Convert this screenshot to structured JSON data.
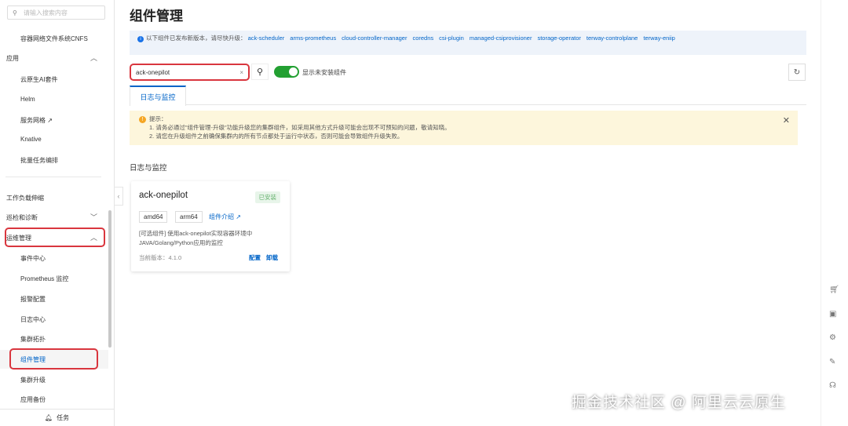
{
  "sidebar": {
    "search_placeholder": "请输入搜索内容",
    "items": [
      "容器网络文件系统CNFS",
      "云原生AI套件",
      "Helm",
      "服务网格",
      "Knative",
      "批量任务编排",
      "事件中心",
      "Prometheus 监控",
      "报警配置",
      "日志中心",
      "集群拓扑",
      "组件管理",
      "集群升级",
      "应用备份"
    ],
    "groups": [
      "应用",
      "工作负载伸缩",
      "巡检和诊断",
      "运维管理"
    ],
    "footer": "任务"
  },
  "page": {
    "title": "组件管理"
  },
  "notice": {
    "text": "以下组件已发布新版本，请尽快升级：",
    "components": [
      "ack-scheduler",
      "arms-prometheus",
      "cloud-controller-manager",
      "coredns",
      "csi-plugin",
      "managed-csiprovisioner",
      "storage-operator",
      "terway-controlplane",
      "terway-eniip"
    ]
  },
  "search": {
    "value": "ack-onepilot"
  },
  "toggle": {
    "label": "显示未安装组件",
    "on": true
  },
  "tabs": [
    "日志与监控"
  ],
  "tip": {
    "title": "提示：",
    "lines": [
      "1. 请务必通过\"组件管理-升级\"功能升级您的集群组件，如采用其他方式升级可能会出现不可预知的问题，敬请知晓。",
      "2. 请您在升级组件之前确保集群内的所有节点都处于运行中状态，否则可能会导致组件升级失败。"
    ]
  },
  "section": "日志与监控",
  "card": {
    "name": "ack-onepilot",
    "status": "已安装",
    "tags": [
      "amd64",
      "arm64"
    ],
    "intro": "组件介绍",
    "desc": "[可选组件] 使用ack-onepilot实现容器环境中JAVA/Golang/Python应用的监控",
    "version": "当前版本：4.1.0",
    "actions": [
      "配置",
      "卸载"
    ]
  },
  "watermark": "掘金技术社区 @ 阿里云云原生"
}
